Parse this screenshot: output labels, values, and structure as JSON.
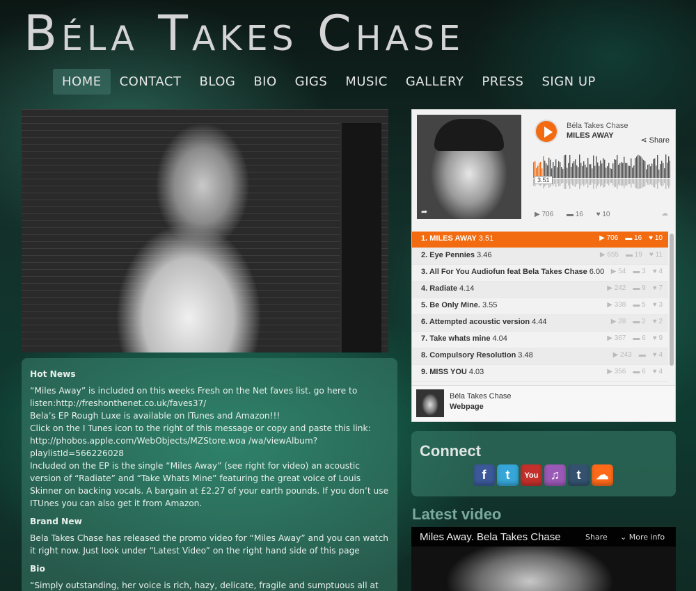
{
  "site": {
    "title": "Béla Takes Chase"
  },
  "nav": {
    "items": [
      "HOME",
      "CONTACT",
      "BLOG",
      "BIO",
      "GIGS",
      "MUSIC",
      "GALLERY",
      "PRESS",
      "SIGN UP"
    ],
    "active": "HOME"
  },
  "news": {
    "hot_heading": "Hot News",
    "hot_lines": [
      "“Miles Away” is included on this weeks Fresh on the Net faves list. go here to listen:http://freshonthenet.co.uk/faves37/",
      "Bela’s EP Rough Luxe is available on ITunes and Amazon!!!",
      "Click on the I Tunes icon to the right of this message or copy and paste this link: http://phobos.apple.com/WebObjects/MZStore.woa /wa/viewAlbum?playlistId=566226028",
      "Included on the EP is the single “Miles Away” (see right for video) an acoustic version of “Radiate” and “Take Whats Mine” featuring the great voice of Louis Skinner on backing vocals. A bargain at £2.27 of your earth pounds. If you don’t use ITUnes you can also get it from Amazon."
    ],
    "brand_heading": "Brand New",
    "brand_text": "Bela Takes Chase has released the promo video for “Miles Away” and you can watch it right now. Just look under “Latest Video” on the right hand side of this page",
    "bio_heading": "Bio",
    "bio_text": "“Simply outstanding, her voice is rich, hazy, delicate, fragile and sumptuous all at the"
  },
  "player": {
    "artist": "Béla Takes Chase",
    "track": "MILES AWAY",
    "share_label": "Share",
    "time_badge": "3.51",
    "plays": "706",
    "comments": "16",
    "likes": "10",
    "accent": "#f26b10",
    "tracks": [
      {
        "name": "1. MILES AWAY",
        "dur": "3.51",
        "plays": "706",
        "comments": "16",
        "likes": "10"
      },
      {
        "name": "2. Eye Pennies",
        "dur": "3.46",
        "plays": "655",
        "comments": "19",
        "likes": "11"
      },
      {
        "name": "3. All For You Audiofun feat Bela Takes Chase",
        "dur": "6.00",
        "plays": "54",
        "comments": "3",
        "likes": "4"
      },
      {
        "name": "4. Radiate",
        "dur": "4.14",
        "plays": "242",
        "comments": "9",
        "likes": "7"
      },
      {
        "name": "5. Be Only Mine.",
        "dur": "3.55",
        "plays": "338",
        "comments": "5",
        "likes": "3"
      },
      {
        "name": "6. Attempted acoustic version",
        "dur": "4.44",
        "plays": "28",
        "comments": "2",
        "likes": "2"
      },
      {
        "name": "7. Take whats mine",
        "dur": "4.04",
        "plays": "367",
        "comments": "6",
        "likes": "9"
      },
      {
        "name": "8. Compulsory Resolution",
        "dur": "3.48",
        "plays": "243",
        "comments": "",
        "likes": "4"
      },
      {
        "name": "9. MISS YOU",
        "dur": "4.03",
        "plays": "356",
        "comments": "6",
        "likes": "4"
      }
    ],
    "footer_artist": "Béla Takes Chase",
    "footer_link": "Webpage"
  },
  "connect": {
    "title": "Connect",
    "icons": [
      {
        "name": "facebook-icon",
        "glyph": "f",
        "color": "#3b5998"
      },
      {
        "name": "twitter-icon",
        "glyph": "t",
        "color": "#36a6d8"
      },
      {
        "name": "youtube-icon",
        "glyph": "You",
        "color": "#c4302b"
      },
      {
        "name": "itunes-icon",
        "glyph": "♫",
        "color": "#9b59b6"
      },
      {
        "name": "tumblr-icon",
        "glyph": "t",
        "color": "#34526f"
      },
      {
        "name": "soundcloud-icon",
        "glyph": "☁",
        "color": "#ff6a1a"
      }
    ]
  },
  "video": {
    "section_title": "Latest video",
    "title": "Miles Away. Bela Takes Chase",
    "share_label": "Share",
    "more_label": "More info"
  }
}
